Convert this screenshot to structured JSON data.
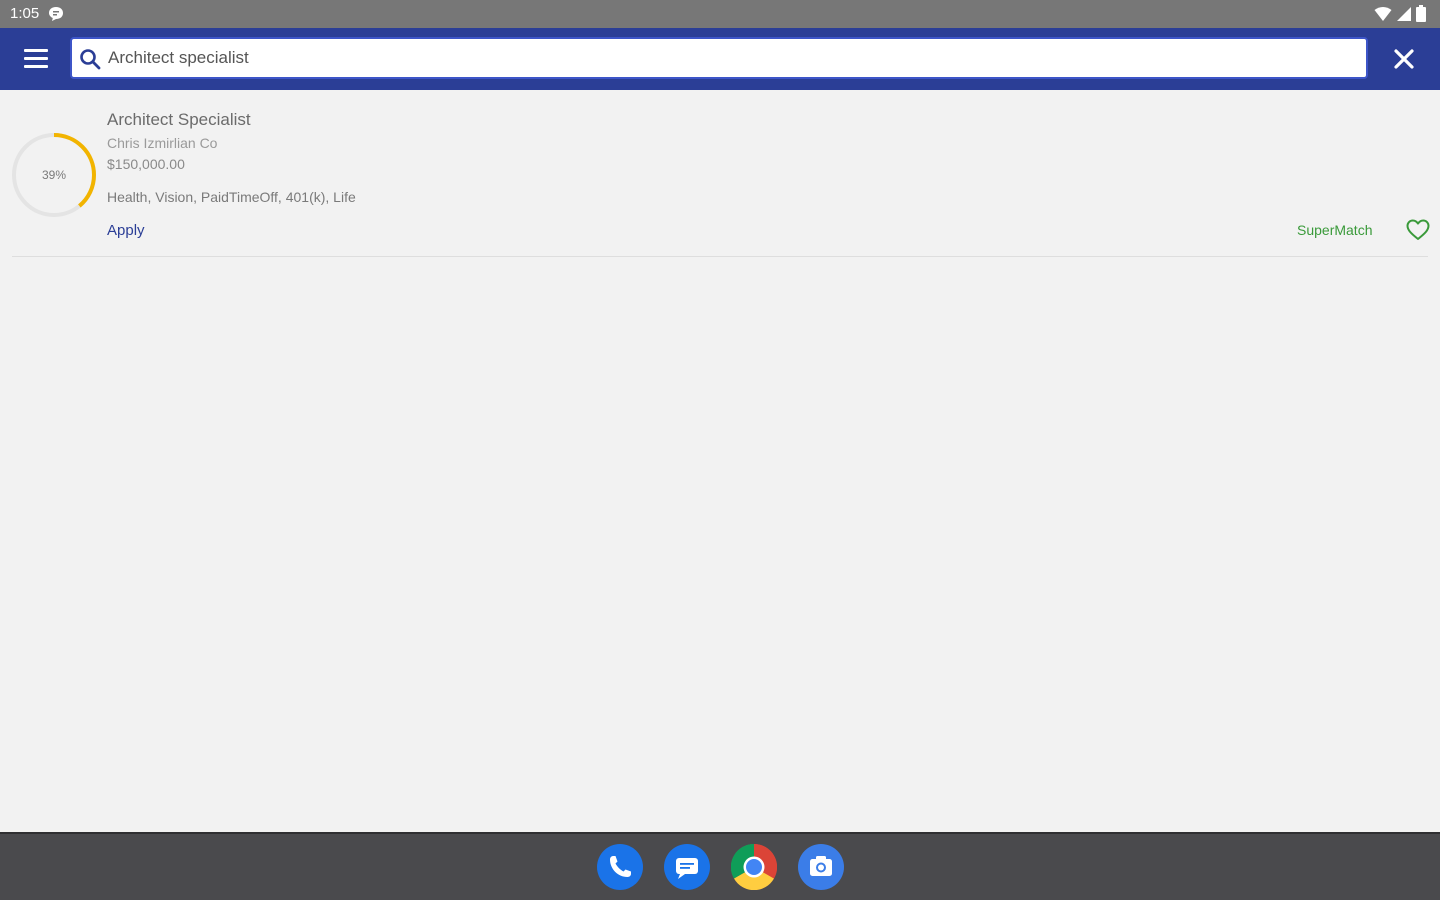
{
  "status_bar": {
    "time": "1:05",
    "icons": [
      "message-notification-icon",
      "wifi-icon",
      "signal-icon",
      "battery-icon"
    ]
  },
  "app_bar": {
    "menu_icon": "hamburger-menu-icon",
    "search": {
      "value": "Architect specialist",
      "icon": "search-icon"
    },
    "close_icon": "close-icon",
    "color": "#2b3e96"
  },
  "results": [
    {
      "match_percent": 39,
      "match_label": "39%",
      "title": "Architect Specialist",
      "company": "Chris Izmirlian Co",
      "salary": "$150,000.00",
      "benefits": "Health, Vision, PaidTimeOff, 401(k), Life",
      "apply_label": "Apply",
      "match_type": "SuperMatch",
      "favorite_icon": "heart-outline-icon"
    }
  ],
  "dock": {
    "apps": [
      "phone-icon",
      "messages-icon",
      "chrome-icon",
      "camera-icon"
    ]
  },
  "colors": {
    "accent": "#2b3e96",
    "progress": "#f2b400",
    "supermatch": "#3a9a3a",
    "background": "#f2f2f2"
  }
}
